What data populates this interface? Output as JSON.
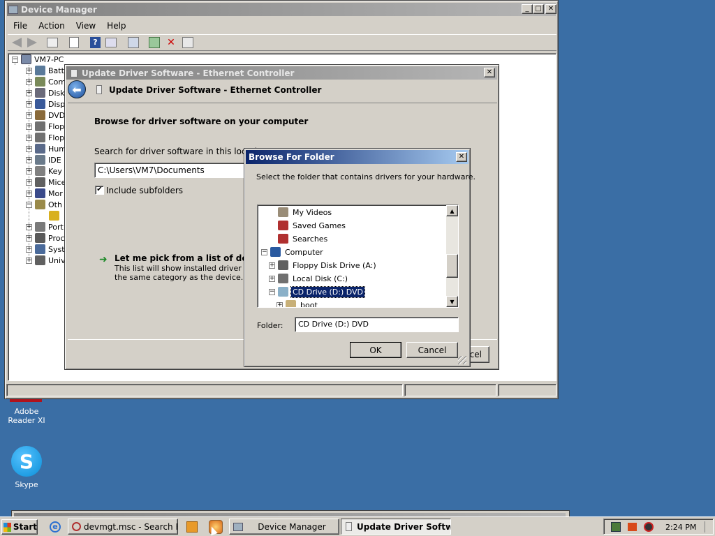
{
  "device_manager": {
    "title": "Device Manager",
    "menu": [
      "File",
      "Action",
      "View",
      "Help"
    ],
    "root": "VM7-PC",
    "tree_items": [
      "Batt",
      "Com",
      "Disk",
      "Disp",
      "DVD",
      "Flop",
      "Flop",
      "Hum",
      "IDE",
      "Key",
      "Mice",
      "Mor",
      "Oth",
      "",
      "Port",
      "Proc",
      "Syst",
      "Univ"
    ]
  },
  "update_driver": {
    "title": "Update Driver Software - Ethernet Controller",
    "header": "Update Driver Software - Ethernet Controller",
    "heading": "Browse for driver software on your computer",
    "search_label": "Search for driver software in this location",
    "search_value": "C:\\Users\\VM7\\Documents",
    "include_subfolders": "Include subfolders",
    "pick_title": "Let me pick from a list of device d",
    "pick_desc1": "This list will show installed driver softwa",
    "pick_desc2": "the same category as the device.",
    "cancel_partial": "cel"
  },
  "browse_folder": {
    "title": "Browse For Folder",
    "instruction": "Select the folder that contains drivers for your hardware.",
    "tree": [
      {
        "label": "My Videos",
        "indent": 2,
        "expander": "",
        "icon": "videos-icon",
        "color": "#9a8d78"
      },
      {
        "label": "Saved Games",
        "indent": 2,
        "expander": "",
        "icon": "games-icon",
        "color": "#b03030"
      },
      {
        "label": "Searches",
        "indent": 2,
        "expander": "",
        "icon": "searches-icon",
        "color": "#b03030"
      },
      {
        "label": "Computer",
        "indent": 1,
        "expander": "−",
        "icon": "computer-icon",
        "color": "#2a5aa0"
      },
      {
        "label": "Floppy Disk Drive (A:)",
        "indent": 2,
        "expander": "+",
        "icon": "floppy-icon",
        "color": "#606060"
      },
      {
        "label": "Local Disk (C:)",
        "indent": 2,
        "expander": "+",
        "icon": "disk-icon",
        "color": "#707070"
      },
      {
        "label": "CD Drive (D:) DVD",
        "indent": 2,
        "expander": "−",
        "icon": "cd-drive-icon",
        "color": "#8ab0c8",
        "selected": true
      },
      {
        "label": "boot",
        "indent": 3,
        "expander": "+",
        "icon": "folder-icon",
        "color": "#c8b078"
      }
    ],
    "folder_label": "Folder:",
    "folder_value": "CD Drive (D:) DVD",
    "ok": "OK",
    "cancel": "Cancel"
  },
  "desktop": {
    "adobe_label": "Adobe Reader XI",
    "skype_label": "Skype"
  },
  "taskbar": {
    "start": "Start",
    "tasks": [
      "devmgt.msc - Search Re...",
      "Device Manager",
      "Update Driver Softwa..."
    ],
    "clock": "2:24 PM"
  },
  "colors": {
    "desktop": "#3a6ea5",
    "active_title": "#0a246a",
    "inactive_title": "#808080",
    "selection": "#0a246a"
  }
}
